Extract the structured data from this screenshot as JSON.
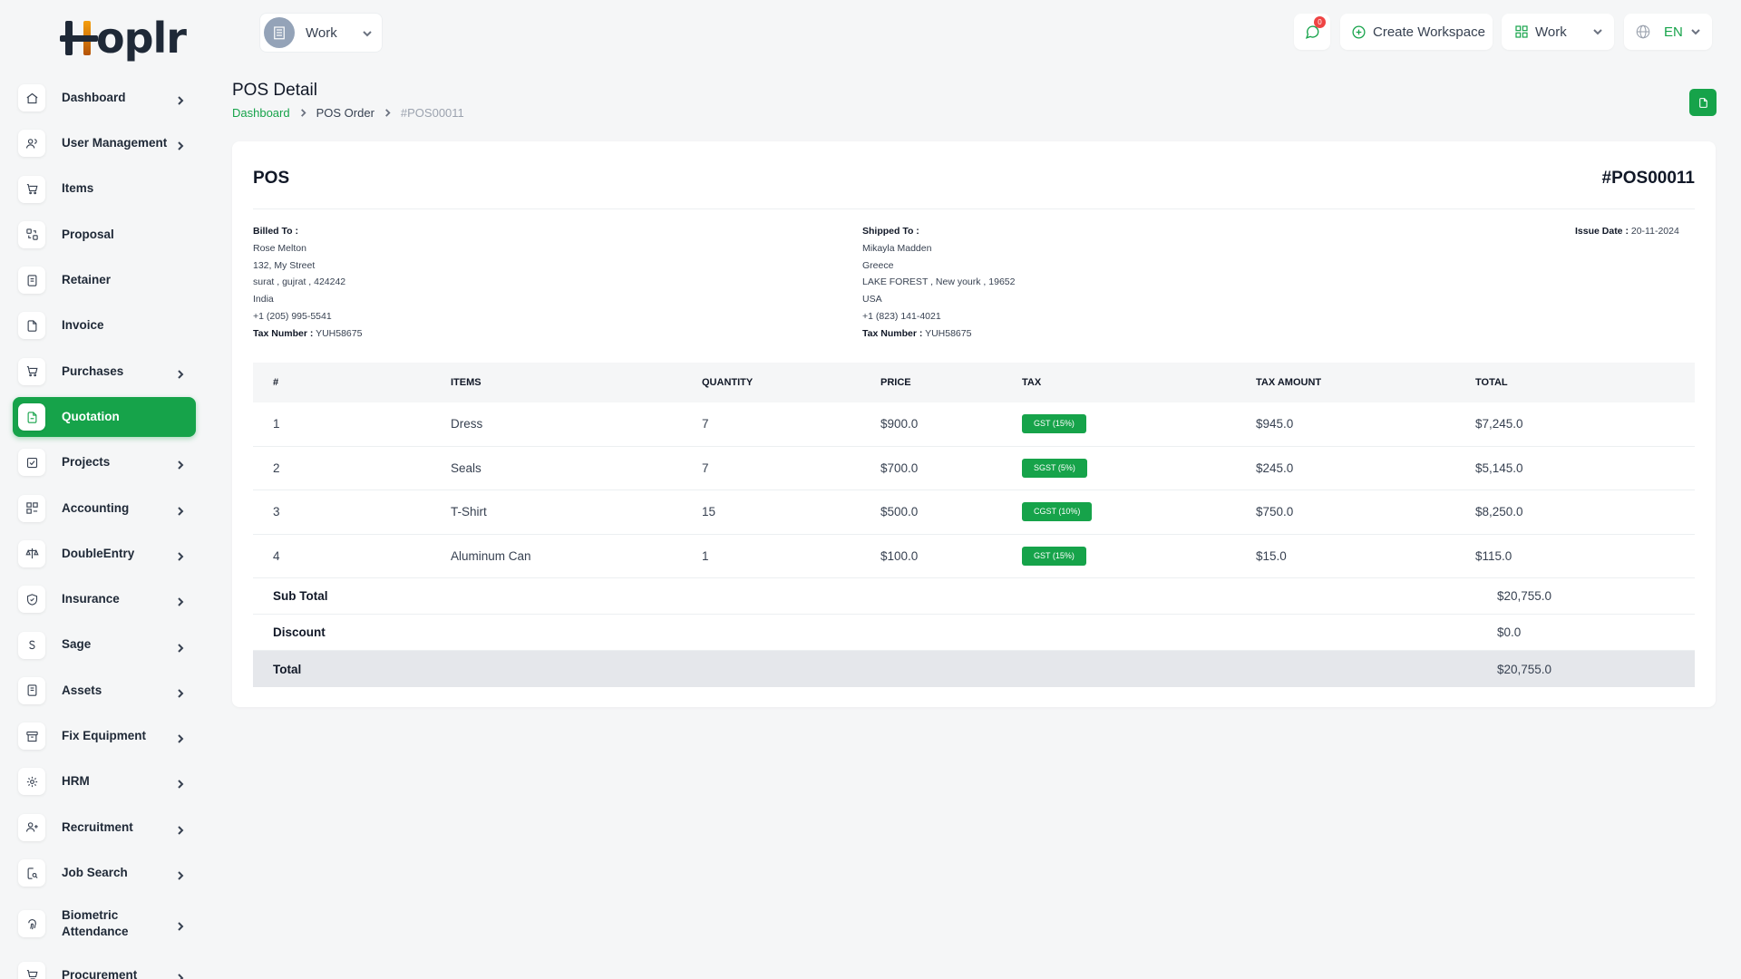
{
  "app": {
    "logo_text": "Hoplr"
  },
  "sidebar": {
    "items": [
      {
        "label": "Dashboard",
        "icon": "home-icon"
      },
      {
        "label": "User Management",
        "icon": "users-icon"
      },
      {
        "label": "Items",
        "icon": "cart-icon"
      },
      {
        "label": "Proposal",
        "icon": "proposal-icon"
      },
      {
        "label": "Retainer",
        "icon": "retainer-icon"
      },
      {
        "label": "Invoice",
        "icon": "invoice-icon"
      },
      {
        "label": "Purchases",
        "icon": "cart-icon"
      },
      {
        "label": "Quotation",
        "icon": "quotation-icon"
      },
      {
        "label": "Projects",
        "icon": "projects-icon"
      },
      {
        "label": "Accounting",
        "icon": "accounting-icon"
      },
      {
        "label": "DoubleEntry",
        "icon": "scale-icon"
      },
      {
        "label": "Insurance",
        "icon": "shield-icon"
      },
      {
        "label": "Sage",
        "icon": "sage-icon"
      },
      {
        "label": "Assets",
        "icon": "assets-icon"
      },
      {
        "label": "Fix Equipment",
        "icon": "archive-icon"
      },
      {
        "label": "HRM",
        "icon": "hrm-icon"
      },
      {
        "label": "Recruitment",
        "icon": "user-plus-icon"
      },
      {
        "label": "Job Search",
        "icon": "job-search-icon"
      },
      {
        "label": "Biometric Attendance",
        "icon": "fingerprint-icon"
      },
      {
        "label": "Procurement",
        "icon": "procurement-icon"
      }
    ]
  },
  "topbar": {
    "workspace_name": "Work",
    "notification_count": "0",
    "create_workspace_label": "Create Workspace",
    "work_label": "Work",
    "language": "EN"
  },
  "page": {
    "title": "POS Detail",
    "breadcrumb": [
      "Dashboard",
      "POS Order",
      "#POS00011"
    ]
  },
  "card": {
    "title": "POS",
    "number": "#POS00011",
    "billed_to": {
      "heading": "Billed To :",
      "name": "Rose Melton",
      "street": "132, My Street",
      "city_line": "surat , gujrat , 424242",
      "country": "India",
      "phone": "+1 (205) 995-5541",
      "tax_label": "Tax Number :",
      "tax_number": "YUH58675"
    },
    "shipped_to": {
      "heading": "Shipped To :",
      "name": "Mikayla Madden",
      "street": "Greece",
      "city_line": "LAKE FOREST , New yourk , 19652",
      "country": "USA",
      "phone": "+1 (823) 141-4021",
      "tax_label": "Tax Number :",
      "tax_number": "YUH58675"
    },
    "issue_date_label": "Issue Date :",
    "issue_date": "20-11-2024"
  },
  "table": {
    "headers": [
      "#",
      "ITEMS",
      "QUANTITY",
      "PRICE",
      "TAX",
      "TAX AMOUNT",
      "TOTAL"
    ],
    "rows": [
      [
        "1",
        "Dress",
        "7",
        "$900.0",
        "GST (15%)",
        "$945.0",
        "$7,245.0"
      ],
      [
        "2",
        "Seals",
        "7",
        "$700.0",
        "SGST (5%)",
        "$245.0",
        "$5,145.0"
      ],
      [
        "3",
        "T-Shirt",
        "15",
        "$500.0",
        "CGST (10%)",
        "$750.0",
        "$8,250.0"
      ],
      [
        "4",
        "Aluminum Can",
        "1",
        "$100.0",
        "GST (15%)",
        "$15.0",
        "$115.0"
      ]
    ],
    "sub_total_label": "Sub Total",
    "sub_total": "$20,755.0",
    "discount_label": "Discount",
    "discount": "$0.0",
    "total_label": "Total",
    "total": "$20,755.0"
  },
  "colors": {
    "accent": "#16a34a",
    "badge": "#ef4444"
  }
}
